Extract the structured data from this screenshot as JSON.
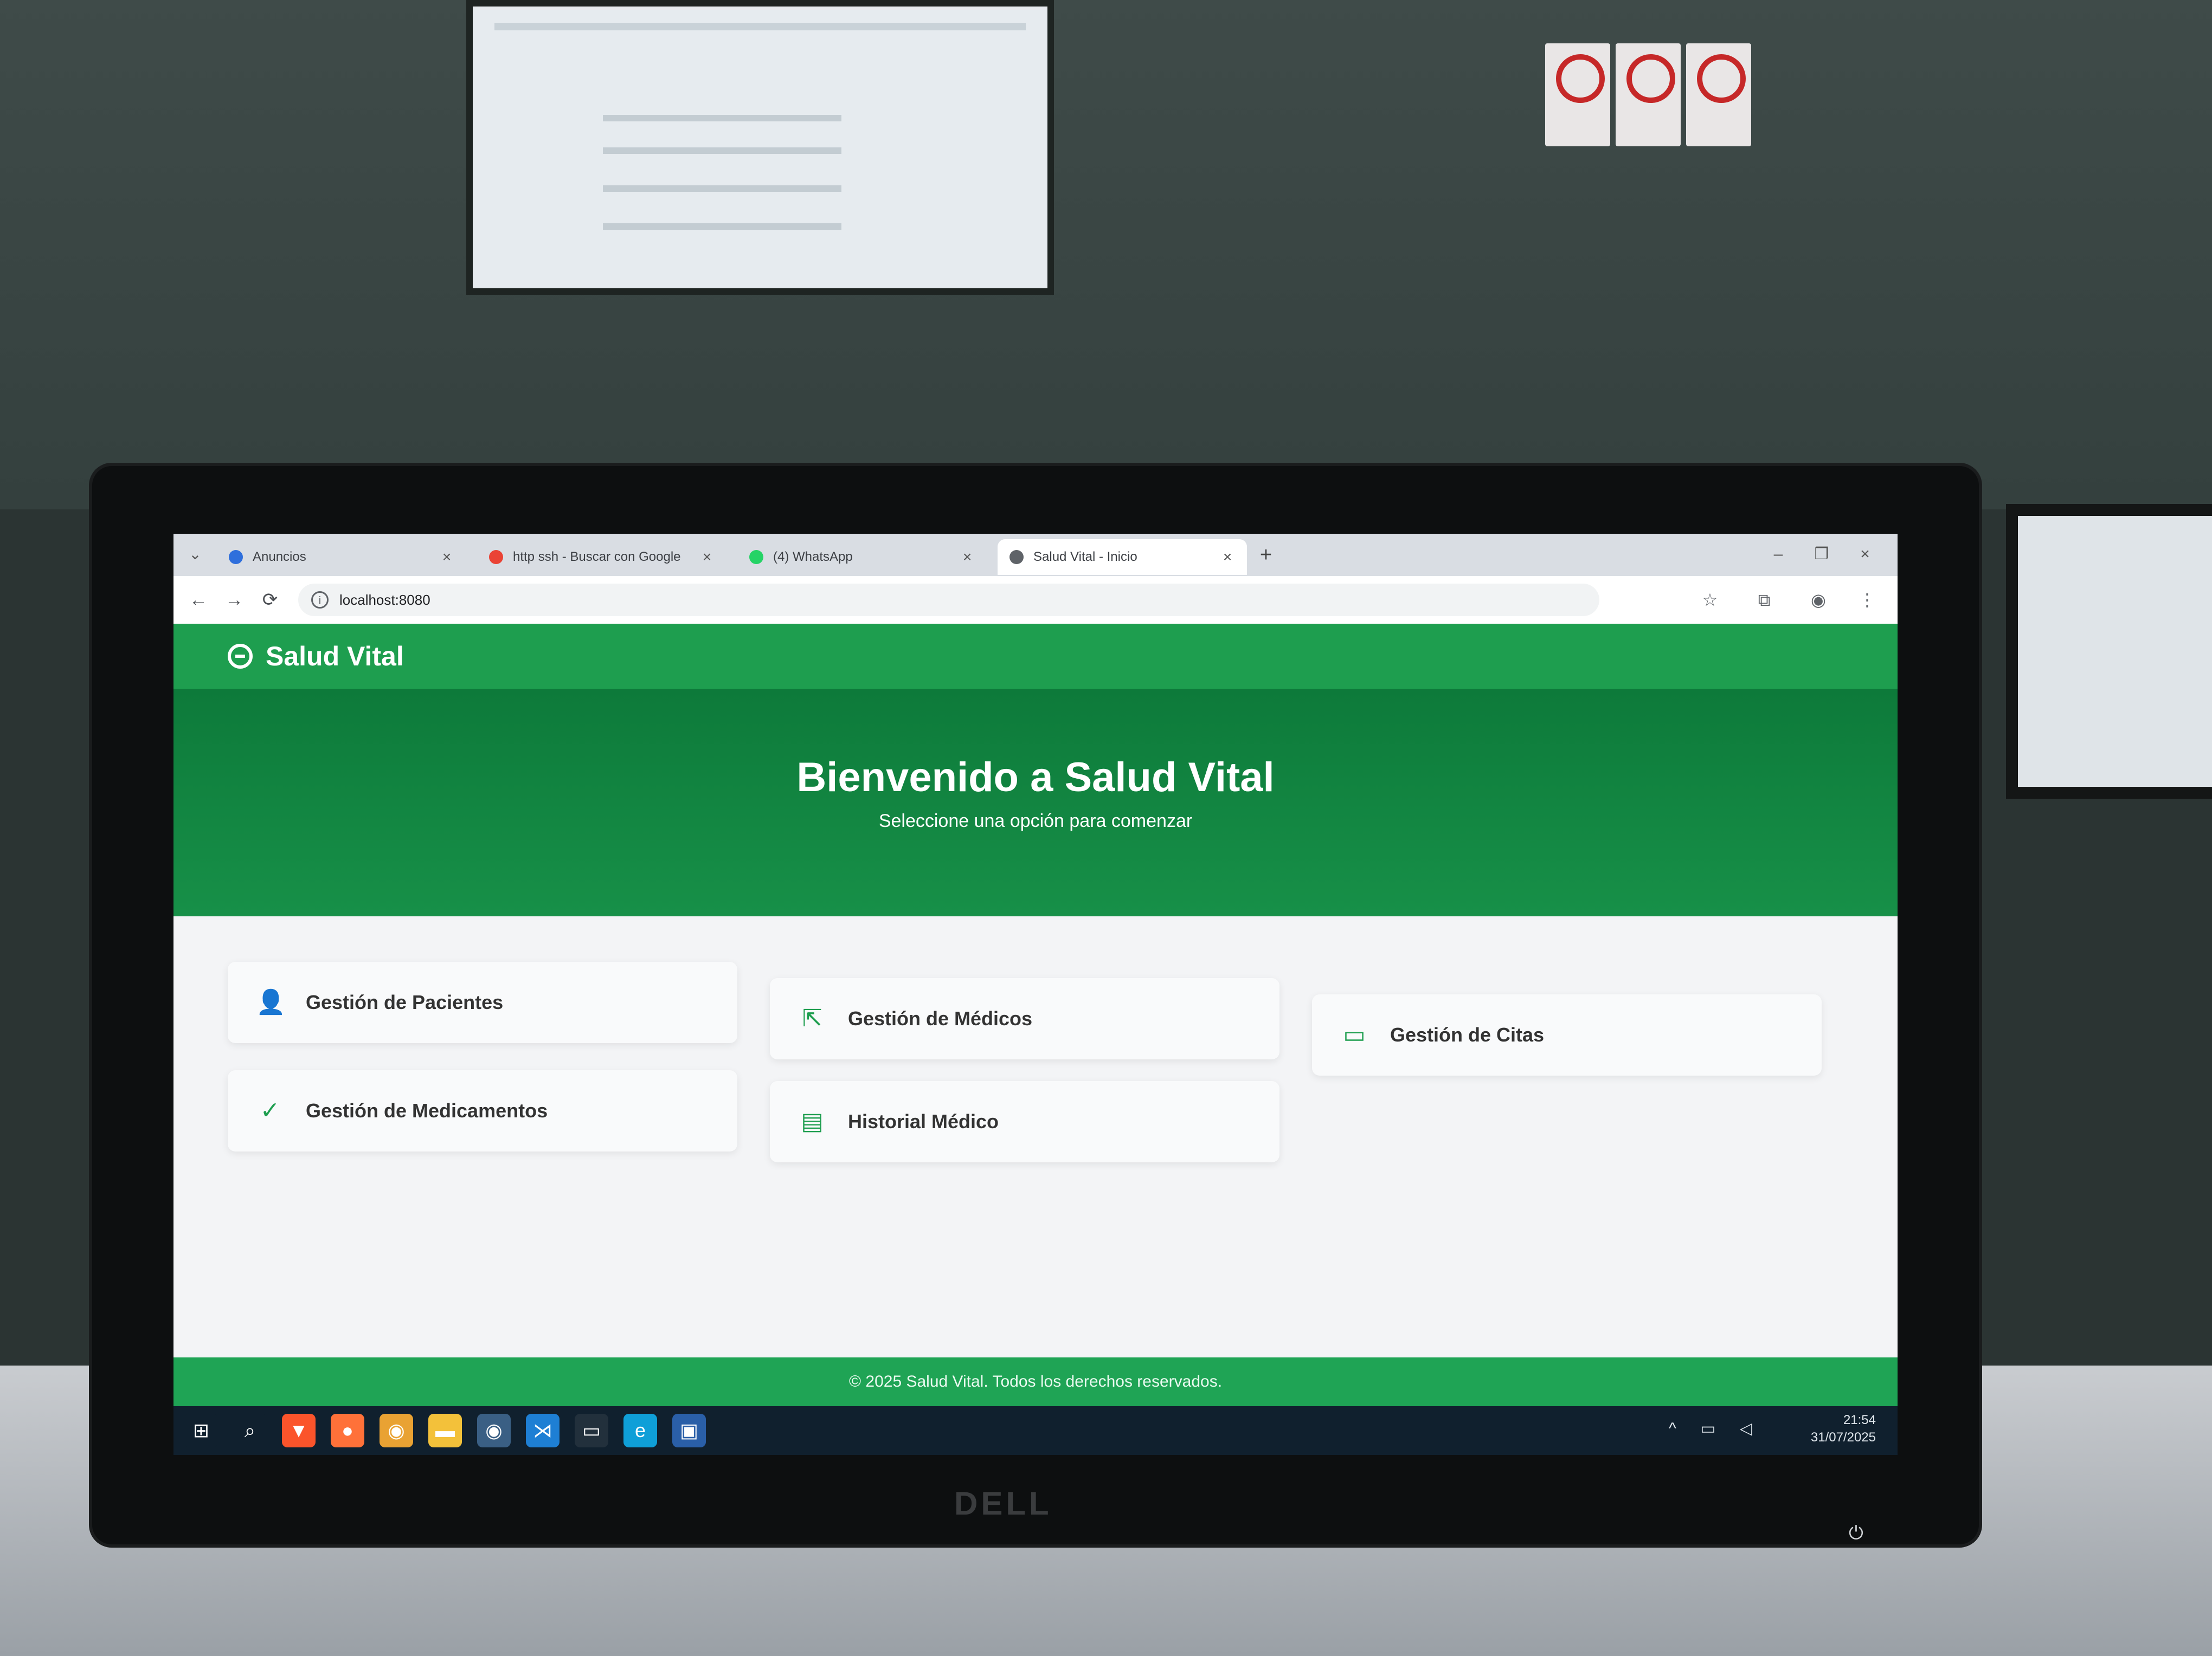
{
  "browser": {
    "tabs": [
      {
        "title": "Anuncios",
        "favicon_color": "#2f6fdc",
        "active": false
      },
      {
        "title": "http ssh - Buscar con Google",
        "favicon_color": "#ea4335",
        "active": false
      },
      {
        "title": "(4) WhatsApp",
        "favicon_color": "#25d366",
        "active": false
      },
      {
        "title": "Salud Vital - Inicio",
        "favicon_color": "#5f6368",
        "active": true
      }
    ],
    "tab_close_glyph": "×",
    "new_tab_glyph": "+",
    "url": "localhost:8080",
    "nav": {
      "back": "←",
      "forward": "→",
      "reload": "⟳"
    },
    "window_controls": {
      "minimize": "–",
      "maximize": "❐",
      "close": "×"
    },
    "toolbar_icons": {
      "bookmark": "☆",
      "extensions": "⧉",
      "profile": "◉",
      "menu": "⋮"
    }
  },
  "app": {
    "brand": "Salud Vital",
    "hero_title": "Bienvenido a Salud Vital",
    "hero_subtitle": "Seleccione una opción para comenzar",
    "cards": [
      {
        "label": "Gestión de Pacientes",
        "icon": "user-icon",
        "glyph": "👤"
      },
      {
        "label": "Gestión de Médicos",
        "icon": "doctor-icon",
        "glyph": "⇱"
      },
      {
        "label": "Gestión de Citas",
        "icon": "calendar-icon",
        "glyph": "▭"
      },
      {
        "label": "Gestión de Medicamentos",
        "icon": "pill-icon",
        "glyph": "✓"
      },
      {
        "label": "Historial Médico",
        "icon": "document-icon",
        "glyph": "▤"
      }
    ],
    "footer": "© 2025 Salud Vital. Todos los derechos reservados.",
    "colors": {
      "primary": "#1e9e4f",
      "hero_dark": "#0d7a3a"
    }
  },
  "taskbar": {
    "apps": [
      {
        "name": "start",
        "glyph": "⊞",
        "color": "#10202e"
      },
      {
        "name": "search",
        "glyph": "⌕",
        "color": "#10202e"
      },
      {
        "name": "brave",
        "glyph": "▼",
        "color": "#fb542b"
      },
      {
        "name": "firefox",
        "glyph": "●",
        "color": "#ff7139"
      },
      {
        "name": "chrome",
        "glyph": "◉",
        "color": "#e9a233"
      },
      {
        "name": "files",
        "glyph": "▬",
        "color": "#f3c13a"
      },
      {
        "name": "chrome-active",
        "glyph": "◉",
        "color": "#3a5f84"
      },
      {
        "name": "vscode",
        "glyph": "⋊",
        "color": "#1e7fd4"
      },
      {
        "name": "app",
        "glyph": "▭",
        "color": "#22303c"
      },
      {
        "name": "edge",
        "glyph": "e",
        "color": "#0f9fd8"
      },
      {
        "name": "app2",
        "glyph": "▣",
        "color": "#2a5fa8"
      }
    ],
    "time": "21:54",
    "date": "31/07/2025",
    "tray_glyphs": "^ ▭ ◁"
  },
  "monitor": {
    "brand": "DELL",
    "power_glyph": "⏻"
  }
}
